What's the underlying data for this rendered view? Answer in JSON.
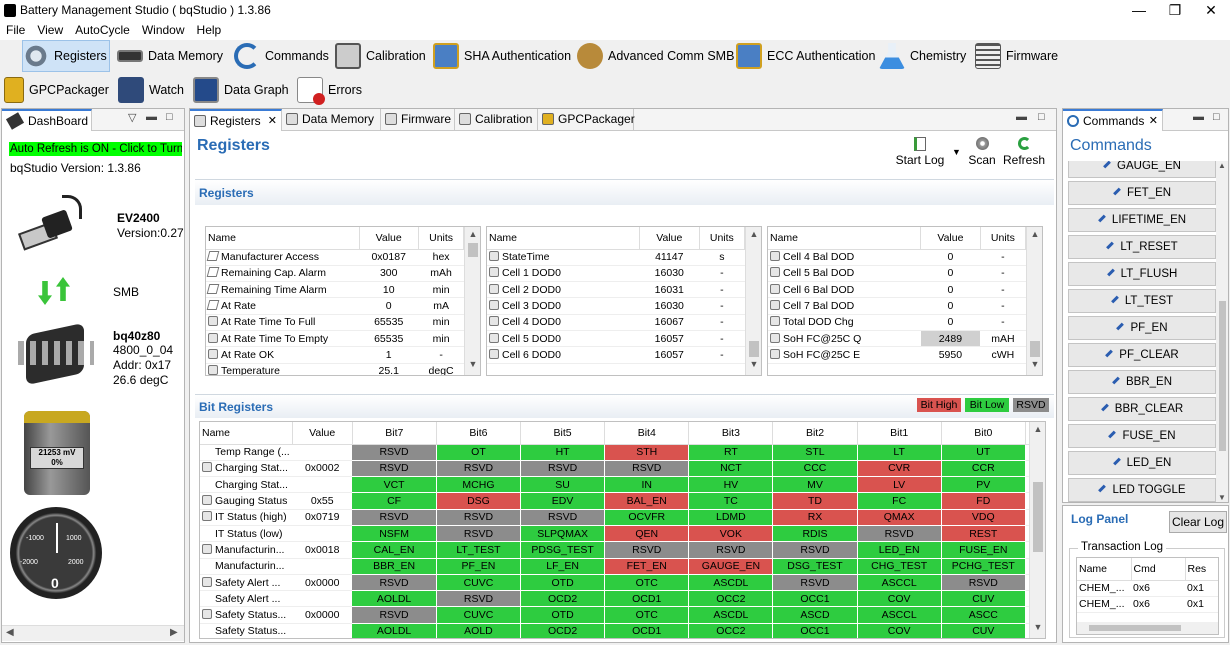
{
  "window": {
    "title": "Battery Management Studio ( bqStudio ) 1.3.86"
  },
  "menu": [
    "File",
    "View",
    "AutoCycle",
    "Window",
    "Help"
  ],
  "toolbar": {
    "row1": [
      "Registers",
      "Data Memory",
      "Commands",
      "Calibration",
      "SHA Authentication",
      "Advanced Comm SMB",
      "ECC Authentication",
      "Chemistry",
      "Firmware"
    ],
    "row2": [
      "GPCPackager",
      "Watch",
      "Data Graph",
      "Errors"
    ]
  },
  "dashboard": {
    "tab": "DashBoard",
    "auto_refresh": "Auto Refresh is ON - Click to Turn",
    "version": "bqStudio Version:  1.3.86",
    "adapter_name": "EV2400",
    "adapter_version": "Version:0.27",
    "bus": "SMB",
    "device_name": "bq40z80",
    "device_fw": "4800_0_04",
    "device_addr": "Addr: 0x17",
    "device_temp": "26.6 degC",
    "battery_mv": "21253 mV",
    "battery_pct": "0%",
    "gauge_labels": [
      "-1000",
      "1000",
      "-2000",
      "2000"
    ],
    "gauge_value": "0"
  },
  "center": {
    "tabs": [
      "Registers",
      "Data Memory",
      "Firmware",
      "Calibration",
      "GPCPackager"
    ],
    "title": "Registers",
    "actions": {
      "start_log": "Start Log",
      "scan": "Scan",
      "refresh": "Refresh"
    },
    "section_registers": "Registers",
    "section_bits": "Bit Registers",
    "legend": {
      "high": "Bit High",
      "low": "Bit Low",
      "rsvd": "RSVD"
    }
  },
  "reg_tables": [
    {
      "headers": [
        "Name",
        "Value",
        "Units"
      ],
      "rows": [
        {
          "icon": "pen",
          "name": "Manufacturer Access",
          "value": "0x0187",
          "units": "hex"
        },
        {
          "icon": "pen",
          "name": "Remaining Cap. Alarm",
          "value": "300",
          "units": "mAh"
        },
        {
          "icon": "pen",
          "name": "Remaining Time Alarm",
          "value": "10",
          "units": "min"
        },
        {
          "icon": "pen",
          "name": "At Rate",
          "value": "0",
          "units": "mA"
        },
        {
          "icon": "lock",
          "name": "At Rate Time To Full",
          "value": "65535",
          "units": "min"
        },
        {
          "icon": "lock",
          "name": "At Rate Time To Empty",
          "value": "65535",
          "units": "min"
        },
        {
          "icon": "lock",
          "name": "At Rate OK",
          "value": "1",
          "units": "-"
        },
        {
          "icon": "lock",
          "name": "Temperature",
          "value": "25.1",
          "units": "degC"
        }
      ]
    },
    {
      "headers": [
        "Name",
        "Value",
        "Units"
      ],
      "rows": [
        {
          "icon": "lock",
          "name": "StateTime",
          "value": "41147",
          "units": "s"
        },
        {
          "icon": "lock",
          "name": "Cell 1 DOD0",
          "value": "16030",
          "units": "-"
        },
        {
          "icon": "lock",
          "name": "Cell 2 DOD0",
          "value": "16031",
          "units": "-"
        },
        {
          "icon": "lock",
          "name": "Cell 3 DOD0",
          "value": "16030",
          "units": "-"
        },
        {
          "icon": "lock",
          "name": "Cell 4 DOD0",
          "value": "16067",
          "units": "-"
        },
        {
          "icon": "lock",
          "name": "Cell 5 DOD0",
          "value": "16057",
          "units": "-"
        },
        {
          "icon": "lock",
          "name": "Cell 6 DOD0",
          "value": "16057",
          "units": "-"
        }
      ]
    },
    {
      "headers": [
        "Name",
        "Value",
        "Units"
      ],
      "rows": [
        {
          "icon": "lock",
          "name": "Cell 4 Bal DOD",
          "value": "0",
          "units": "-"
        },
        {
          "icon": "lock",
          "name": "Cell 5 Bal DOD",
          "value": "0",
          "units": "-"
        },
        {
          "icon": "lock",
          "name": "Cell 6 Bal DOD",
          "value": "0",
          "units": "-"
        },
        {
          "icon": "lock",
          "name": "Cell 7 Bal DOD",
          "value": "0",
          "units": "-"
        },
        {
          "icon": "lock",
          "name": "Total DOD Chg",
          "value": "0",
          "units": "-"
        },
        {
          "icon": "lock",
          "name": "SoH FC@25C Q",
          "value": "2489",
          "units": "mAH",
          "highlight": true
        },
        {
          "icon": "lock",
          "name": "SoH FC@25C E",
          "value": "5950",
          "units": "cWH"
        }
      ]
    }
  ],
  "bit_table": {
    "headers": [
      "Name",
      "Value",
      "Bit7",
      "Bit6",
      "Bit5",
      "Bit4",
      "Bit3",
      "Bit2",
      "Bit1",
      "Bit0"
    ],
    "rows": [
      {
        "icon": "",
        "name": "Temp Range (...",
        "value": "",
        "bits": [
          [
            "RSVD",
            "x"
          ],
          [
            "OT",
            "g"
          ],
          [
            "HT",
            "g"
          ],
          [
            "STH",
            "r"
          ],
          [
            "RT",
            "g"
          ],
          [
            "STL",
            "g"
          ],
          [
            "LT",
            "g"
          ],
          [
            "UT",
            "g"
          ]
        ]
      },
      {
        "icon": "lock",
        "name": "Charging Stat...",
        "value": "0x0002",
        "bits": [
          [
            "RSVD",
            "x"
          ],
          [
            "RSVD",
            "x"
          ],
          [
            "RSVD",
            "x"
          ],
          [
            "RSVD",
            "x"
          ],
          [
            "NCT",
            "g"
          ],
          [
            "CCC",
            "g"
          ],
          [
            "CVR",
            "r"
          ],
          [
            "CCR",
            "g"
          ]
        ]
      },
      {
        "icon": "",
        "name": "Charging Stat...",
        "value": "",
        "bits": [
          [
            "VCT",
            "g"
          ],
          [
            "MCHG",
            "g"
          ],
          [
            "SU",
            "g"
          ],
          [
            "IN",
            "g"
          ],
          [
            "HV",
            "g"
          ],
          [
            "MV",
            "g"
          ],
          [
            "LV",
            "r"
          ],
          [
            "PV",
            "g"
          ]
        ]
      },
      {
        "icon": "lock",
        "name": "Gauging Status",
        "value": "0x55",
        "bits": [
          [
            "CF",
            "g"
          ],
          [
            "DSG",
            "r"
          ],
          [
            "EDV",
            "g"
          ],
          [
            "BAL_EN",
            "r"
          ],
          [
            "TC",
            "g"
          ],
          [
            "TD",
            "r"
          ],
          [
            "FC",
            "g"
          ],
          [
            "FD",
            "r"
          ]
        ]
      },
      {
        "icon": "lock",
        "name": "IT Status (high)",
        "value": "0x0719",
        "bits": [
          [
            "RSVD",
            "x"
          ],
          [
            "RSVD",
            "x"
          ],
          [
            "RSVD",
            "x"
          ],
          [
            "OCVFR",
            "g"
          ],
          [
            "LDMD",
            "g"
          ],
          [
            "RX",
            "r"
          ],
          [
            "QMAX",
            "r"
          ],
          [
            "VDQ",
            "r"
          ]
        ]
      },
      {
        "icon": "",
        "name": "IT Status (low)",
        "value": "",
        "bits": [
          [
            "NSFM",
            "g"
          ],
          [
            "RSVD",
            "x"
          ],
          [
            "SLPQMAX",
            "g"
          ],
          [
            "QEN",
            "r"
          ],
          [
            "VOK",
            "r"
          ],
          [
            "RDIS",
            "g"
          ],
          [
            "RSVD",
            "x"
          ],
          [
            "REST",
            "r"
          ]
        ]
      },
      {
        "icon": "lock",
        "name": "Manufacturin...",
        "value": "0x0018",
        "bits": [
          [
            "CAL_EN",
            "g"
          ],
          [
            "LT_TEST",
            "g"
          ],
          [
            "PDSG_TEST",
            "g"
          ],
          [
            "RSVD",
            "x"
          ],
          [
            "RSVD",
            "x"
          ],
          [
            "RSVD",
            "x"
          ],
          [
            "LED_EN",
            "g"
          ],
          [
            "FUSE_EN",
            "g"
          ]
        ]
      },
      {
        "icon": "",
        "name": "Manufacturin...",
        "value": "",
        "bits": [
          [
            "BBR_EN",
            "g"
          ],
          [
            "PF_EN",
            "g"
          ],
          [
            "LF_EN",
            "g"
          ],
          [
            "FET_EN",
            "r"
          ],
          [
            "GAUGE_EN",
            "r"
          ],
          [
            "DSG_TEST",
            "g"
          ],
          [
            "CHG_TEST",
            "g"
          ],
          [
            "PCHG_TEST",
            "g"
          ]
        ]
      },
      {
        "icon": "lock",
        "name": "Safety Alert ...",
        "value": "0x0000",
        "bits": [
          [
            "RSVD",
            "x"
          ],
          [
            "CUVC",
            "g"
          ],
          [
            "OTD",
            "g"
          ],
          [
            "OTC",
            "g"
          ],
          [
            "ASCDL",
            "g"
          ],
          [
            "RSVD",
            "x"
          ],
          [
            "ASCCL",
            "g"
          ],
          [
            "RSVD",
            "x"
          ]
        ]
      },
      {
        "icon": "",
        "name": "Safety Alert ...",
        "value": "",
        "bits": [
          [
            "AOLDL",
            "g"
          ],
          [
            "RSVD",
            "x"
          ],
          [
            "OCD2",
            "g"
          ],
          [
            "OCD1",
            "g"
          ],
          [
            "OCC2",
            "g"
          ],
          [
            "OCC1",
            "g"
          ],
          [
            "COV",
            "g"
          ],
          [
            "CUV",
            "g"
          ]
        ]
      },
      {
        "icon": "lock",
        "name": "Safety Status...",
        "value": "0x0000",
        "bits": [
          [
            "RSVD",
            "x"
          ],
          [
            "CUVC",
            "g"
          ],
          [
            "OTD",
            "g"
          ],
          [
            "OTC",
            "g"
          ],
          [
            "ASCDL",
            "g"
          ],
          [
            "ASCD",
            "g"
          ],
          [
            "ASCCL",
            "g"
          ],
          [
            "ASCC",
            "g"
          ]
        ]
      },
      {
        "icon": "",
        "name": "Safety Status...",
        "value": "",
        "bits": [
          [
            "AOLDL",
            "g"
          ],
          [
            "AOLD",
            "g"
          ],
          [
            "OCD2",
            "g"
          ],
          [
            "OCD1",
            "g"
          ],
          [
            "OCC2",
            "g"
          ],
          [
            "OCC1",
            "g"
          ],
          [
            "COV",
            "g"
          ],
          [
            "CUV",
            "g"
          ]
        ]
      }
    ]
  },
  "commands": {
    "tab": "Commands",
    "title": "Commands",
    "items": [
      "GAUGE_EN",
      "FET_EN",
      "LIFETIME_EN",
      "LT_RESET",
      "LT_FLUSH",
      "LT_TEST",
      "PF_EN",
      "PF_CLEAR",
      "BBR_EN",
      "BBR_CLEAR",
      "FUSE_EN",
      "LED_EN",
      "LED TOGGLE"
    ]
  },
  "log": {
    "title": "Log Panel",
    "clear": "Clear Log",
    "group": "Transaction Log",
    "headers": [
      "Name",
      "Cmd",
      "Res"
    ],
    "rows": [
      [
        "CHEM_...",
        "0x6",
        "0x1"
      ],
      [
        "CHEM_...",
        "0x6",
        "0x1"
      ]
    ]
  },
  "colors": {
    "bit_high": "#d9534f",
    "bit_low": "#2ecc40",
    "rsvd": "#8c8c8c",
    "accent": "#2a6cb5",
    "auto_refresh": "#00ff00"
  }
}
